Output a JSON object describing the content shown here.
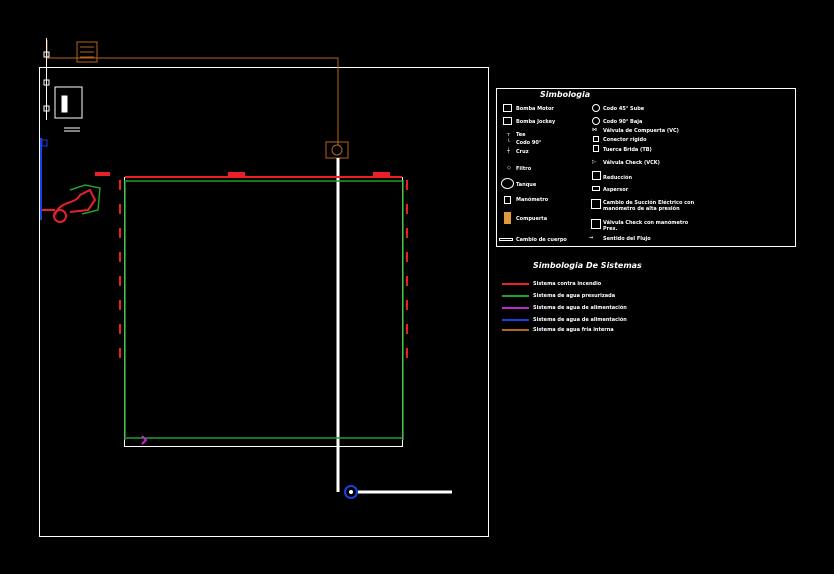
{
  "colors": {
    "background": "#000000",
    "frame": "#ffffff",
    "red_fire": "#e8202a",
    "green_press": "#1fa02a",
    "purple_feed": "#c026d3",
    "blue_feed": "#1d3fe0",
    "brown_cold": "#b5651d"
  },
  "symbology": {
    "title": "Simbologia",
    "items_left": [
      {
        "icon": "electric-pump-icon",
        "label": "Bomba Motor"
      },
      {
        "icon": "jockey-pump-icon",
        "label": "Bomba Jockey"
      },
      {
        "icon": "tee-icon",
        "label": "Tee"
      },
      {
        "icon": "elbow-90-icon",
        "label": "Codo 90°"
      },
      {
        "icon": "cross-icon",
        "label": "Cruz"
      },
      {
        "icon": "strainer-icon",
        "label": "Filtro"
      },
      {
        "icon": "tank-icon",
        "label": "Tanque"
      },
      {
        "icon": "manometer-icon",
        "label": "Manómetro"
      },
      {
        "icon": "valve-icon",
        "label": "Compuerta"
      },
      {
        "icon": "pipe-icon",
        "label": "Cambio de cuerpo"
      }
    ],
    "items_right": [
      {
        "icon": "elbow-45-up-icon",
        "label": "Codo 45° Sube"
      },
      {
        "icon": "elbow-45-down-icon",
        "label": "Codo 90° Baja"
      },
      {
        "icon": "gate-valve-icon",
        "label": "Válvula de Compuerta (VC)"
      },
      {
        "icon": "rigid-connector-icon",
        "label": "Conector rígido"
      },
      {
        "icon": "blind-flange-icon",
        "label": "Tuerca Brida (TB)"
      },
      {
        "icon": "check-valve-icon",
        "label": "Válvula Check (VCK)"
      },
      {
        "icon": "reduction-icon",
        "label": "Reducción"
      },
      {
        "icon": "sprinkler-icon",
        "label": "Aspersor"
      },
      {
        "icon": "trim-pump-icon",
        "label": "Cambio de Succión Eléctrico con manómetro de alta presión"
      },
      {
        "icon": "check-meter-icon",
        "label": "Válvula Check con manómetro Pres."
      },
      {
        "icon": "flow-arrow-icon",
        "label": "Sentido del Flujo"
      }
    ]
  },
  "systems": {
    "title": "Simbologia De Sistemas",
    "items": [
      {
        "color": "#e8202a",
        "label": "Sistema contra incendio"
      },
      {
        "color": "#1fa02a",
        "label": "Sistema de agua presurizada"
      },
      {
        "color": "#c026d3",
        "label": "Sistema de agua de alimentación"
      },
      {
        "color": "#1d3fe0",
        "label": "Sistema de agua de alimentación"
      },
      {
        "color": "#b5651d",
        "label": "Sistema de agua fría interna"
      }
    ]
  }
}
